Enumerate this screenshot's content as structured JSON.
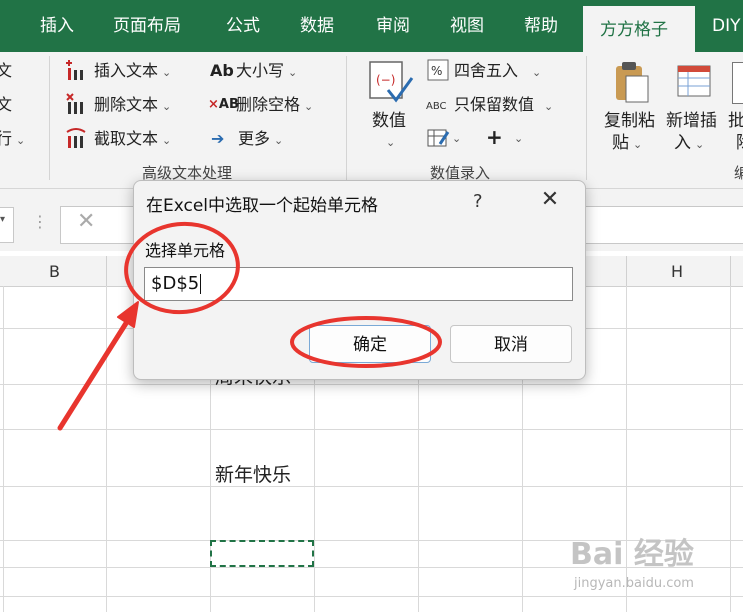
{
  "ribbon_tabs": [
    "插入",
    "页面布局",
    "公式",
    "数据",
    "审阅",
    "视图",
    "帮助",
    "方方格子",
    "DIY"
  ],
  "active_tab": "方方格子",
  "left_partial": [
    "文",
    "文",
    "行"
  ],
  "text_group": {
    "items": [
      "插入文本",
      "删除文本",
      "截取文本"
    ],
    "items2": [
      "大小写",
      "删除空格",
      "更多"
    ],
    "label": "高级文本处理"
  },
  "number_group": {
    "big_button": "数值",
    "items": [
      "四舍五入",
      "只保留数值"
    ],
    "label": "数值录入"
  },
  "right_group": {
    "copy_paste": [
      "复制粘",
      "贴"
    ],
    "insert": [
      "新增插",
      "入"
    ],
    "partial": [
      "批",
      "除",
      "编"
    ]
  },
  "column_headers": {
    "b": "B",
    "h": "H"
  },
  "cells": {
    "d_partial": "周末快乐",
    "d_new_year": "新年快乐"
  },
  "dialog": {
    "title": "在Excel中选取一个起始单元格",
    "help": "?",
    "close": "✕",
    "label": "选择单元格",
    "value": "$D$5",
    "ok": "确定",
    "cancel": "取消"
  },
  "watermark": {
    "text": "jingyan.baidu.com",
    "logo": "Bai 经验"
  },
  "colors": {
    "excel_green": "#217346",
    "annotation_red": "#e8352e"
  }
}
